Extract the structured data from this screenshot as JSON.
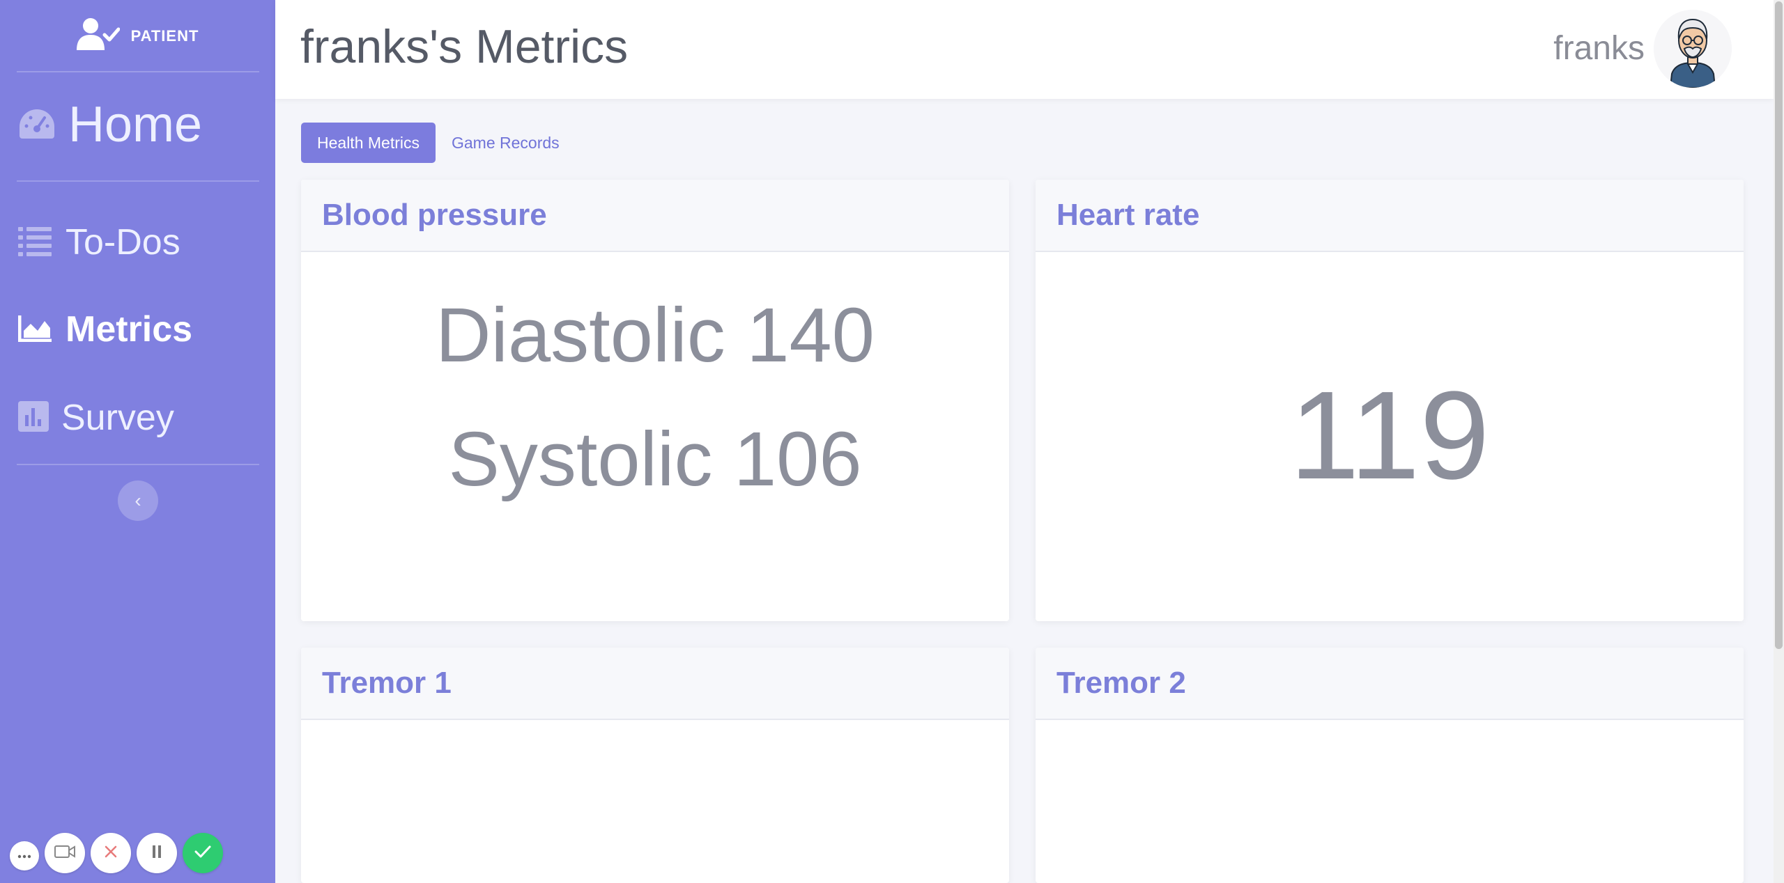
{
  "sidebar": {
    "brand_label": "PATIENT",
    "nav": {
      "home": "Home",
      "todos": "To-Dos",
      "metrics": "Metrics",
      "survey": "Survey"
    },
    "collapse_glyph": "‹",
    "active_item": "Metrics",
    "background_color": "#8080e0"
  },
  "header": {
    "title": "franks's Metrics",
    "username": "franks"
  },
  "tabs": {
    "health_metrics": "Health Metrics",
    "game_records": "Game Records",
    "active": "Health Metrics"
  },
  "cards": {
    "blood_pressure": {
      "title": "Blood pressure",
      "diastolic": "Diastolic 140",
      "systolic": "Systolic 106"
    },
    "heart_rate": {
      "title": "Heart rate",
      "value": "119"
    },
    "tremor1": {
      "title": "Tremor 1"
    },
    "tremor2": {
      "title": "Tremor 2"
    }
  },
  "recorder": {
    "icons": [
      "more-icon",
      "camera-icon",
      "close-icon",
      "pause-icon",
      "check-icon"
    ]
  },
  "colors": {
    "accent": "#7b7fd9",
    "success": "#2ecc71"
  }
}
